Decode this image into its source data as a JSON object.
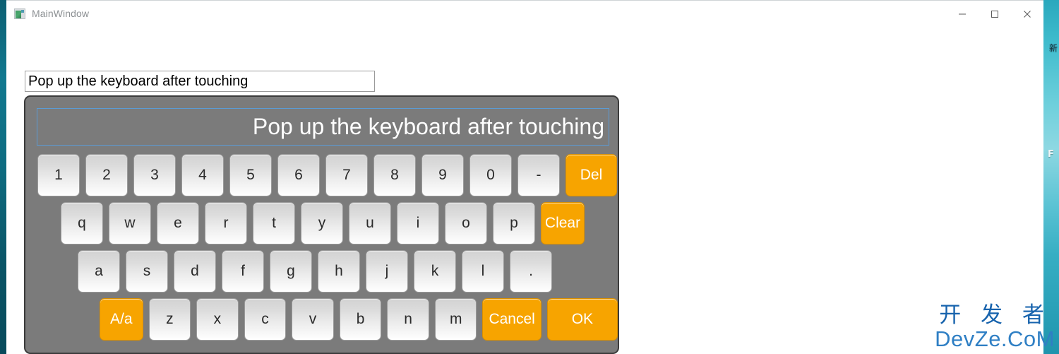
{
  "window": {
    "title": "MainWindow",
    "icon": "app-window-icon",
    "caption": {
      "minimize": "minimize-icon",
      "maximize": "maximize-icon",
      "close": "close-icon"
    }
  },
  "text_input": {
    "value": "Pop up the keyboard after touching",
    "placeholder": ""
  },
  "keyboard": {
    "display_value": "Pop up the keyboard after touching",
    "display_border_color": "#5b9bd5",
    "panel_color": "#7b7b7b",
    "accent_color": "#f7a400",
    "key_text_color": "#2b2b2b",
    "rows": [
      {
        "name": "row-digits",
        "keys": [
          {
            "label": "1",
            "accent": false,
            "width": "normal"
          },
          {
            "label": "2",
            "accent": false,
            "width": "normal"
          },
          {
            "label": "3",
            "accent": false,
            "width": "normal"
          },
          {
            "label": "4",
            "accent": false,
            "width": "normal"
          },
          {
            "label": "5",
            "accent": false,
            "width": "normal"
          },
          {
            "label": "6",
            "accent": false,
            "width": "normal"
          },
          {
            "label": "7",
            "accent": false,
            "width": "normal"
          },
          {
            "label": "8",
            "accent": false,
            "width": "normal"
          },
          {
            "label": "9",
            "accent": false,
            "width": "normal"
          },
          {
            "label": "0",
            "accent": false,
            "width": "normal"
          },
          {
            "label": "-",
            "accent": false,
            "width": "normal"
          },
          {
            "label": "Del",
            "accent": true,
            "width": "del"
          }
        ]
      },
      {
        "name": "row-qwerty",
        "keys": [
          {
            "label": "q",
            "accent": false,
            "width": "normal"
          },
          {
            "label": "w",
            "accent": false,
            "width": "normal"
          },
          {
            "label": "e",
            "accent": false,
            "width": "normal"
          },
          {
            "label": "r",
            "accent": false,
            "width": "normal"
          },
          {
            "label": "t",
            "accent": false,
            "width": "normal"
          },
          {
            "label": "y",
            "accent": false,
            "width": "normal"
          },
          {
            "label": "u",
            "accent": false,
            "width": "normal"
          },
          {
            "label": "i",
            "accent": false,
            "width": "normal"
          },
          {
            "label": "o",
            "accent": false,
            "width": "normal"
          },
          {
            "label": "p",
            "accent": false,
            "width": "normal"
          },
          {
            "label": "Clear",
            "accent": true,
            "width": "clear"
          }
        ]
      },
      {
        "name": "row-asdf",
        "keys": [
          {
            "label": "a",
            "accent": false,
            "width": "normal"
          },
          {
            "label": "s",
            "accent": false,
            "width": "normal"
          },
          {
            "label": "d",
            "accent": false,
            "width": "normal"
          },
          {
            "label": "f",
            "accent": false,
            "width": "normal"
          },
          {
            "label": "g",
            "accent": false,
            "width": "normal"
          },
          {
            "label": "h",
            "accent": false,
            "width": "normal"
          },
          {
            "label": "j",
            "accent": false,
            "width": "normal"
          },
          {
            "label": "k",
            "accent": false,
            "width": "normal"
          },
          {
            "label": "l",
            "accent": false,
            "width": "normal"
          },
          {
            "label": ".",
            "accent": false,
            "width": "normal"
          }
        ]
      },
      {
        "name": "row-zxcv",
        "keys": [
          {
            "label": "A/a",
            "accent": true,
            "width": "aa"
          },
          {
            "label": "z",
            "accent": false,
            "width": "normal"
          },
          {
            "label": "x",
            "accent": false,
            "width": "normal"
          },
          {
            "label": "c",
            "accent": false,
            "width": "normal"
          },
          {
            "label": "v",
            "accent": false,
            "width": "normal"
          },
          {
            "label": "b",
            "accent": false,
            "width": "normal"
          },
          {
            "label": "n",
            "accent": false,
            "width": "normal"
          },
          {
            "label": "m",
            "accent": false,
            "width": "normal"
          },
          {
            "label": "Cancel",
            "accent": true,
            "width": "cancel"
          },
          {
            "label": "OK",
            "accent": true,
            "width": "ok"
          }
        ]
      }
    ]
  },
  "watermark": {
    "chinese": "开 发 者",
    "latin": "DevZe.CoM",
    "color": "#1763ad"
  },
  "desktop": {
    "icon_fragment_top": "新",
    "icon_fragment_mid": "F"
  }
}
